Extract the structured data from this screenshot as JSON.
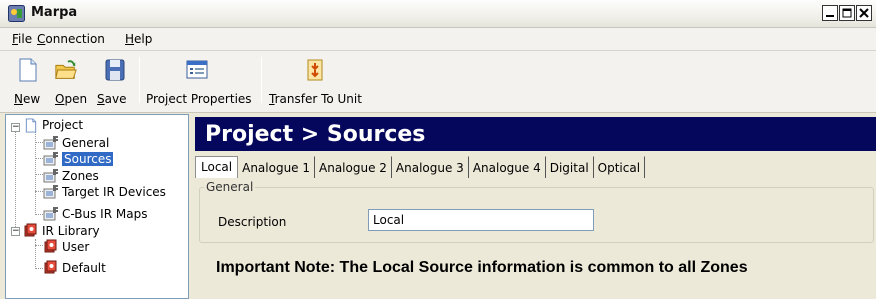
{
  "window": {
    "title": "Marpa"
  },
  "menu": [
    {
      "label": "File",
      "mnemonic": "F",
      "rest": "ile"
    },
    {
      "label": "Connection",
      "mnemonic": "C",
      "rest": "onnection"
    },
    {
      "label": "Help",
      "mnemonic": "H",
      "rest": "elp"
    }
  ],
  "toolbar": {
    "new": {
      "mnemonic": "N",
      "rest": "ew"
    },
    "open": {
      "mnemonic": "O",
      "rest": "pen"
    },
    "save": {
      "mnemonic": "S",
      "rest": "ave"
    },
    "project_properties": {
      "pre": "Pro",
      "mnemonic": "j",
      "rest": "ect Properties"
    },
    "transfer": {
      "mnemonic": "T",
      "rest": "ransfer To Unit"
    }
  },
  "tree": {
    "root": "Project",
    "project_children": [
      "General",
      "Sources",
      "Zones",
      "Target IR Devices",
      "C-Bus IR Maps"
    ],
    "ir_library": "IR Library",
    "ir_children": [
      "User",
      "Default"
    ],
    "selected": "Sources"
  },
  "page": {
    "banner": "Project > Sources",
    "tabs": [
      "Local",
      "Analogue 1",
      "Analogue 2",
      "Analogue 3",
      "Analogue 4",
      "Digital",
      "Optical"
    ],
    "active_tab": "Local",
    "group_title": "General",
    "description_label": "Description",
    "description_value": "Local",
    "note": "Important Note: The Local Source information is common to all Zones"
  },
  "colors": {
    "banner_bg": "#05075c",
    "selection": "#316ac5"
  }
}
